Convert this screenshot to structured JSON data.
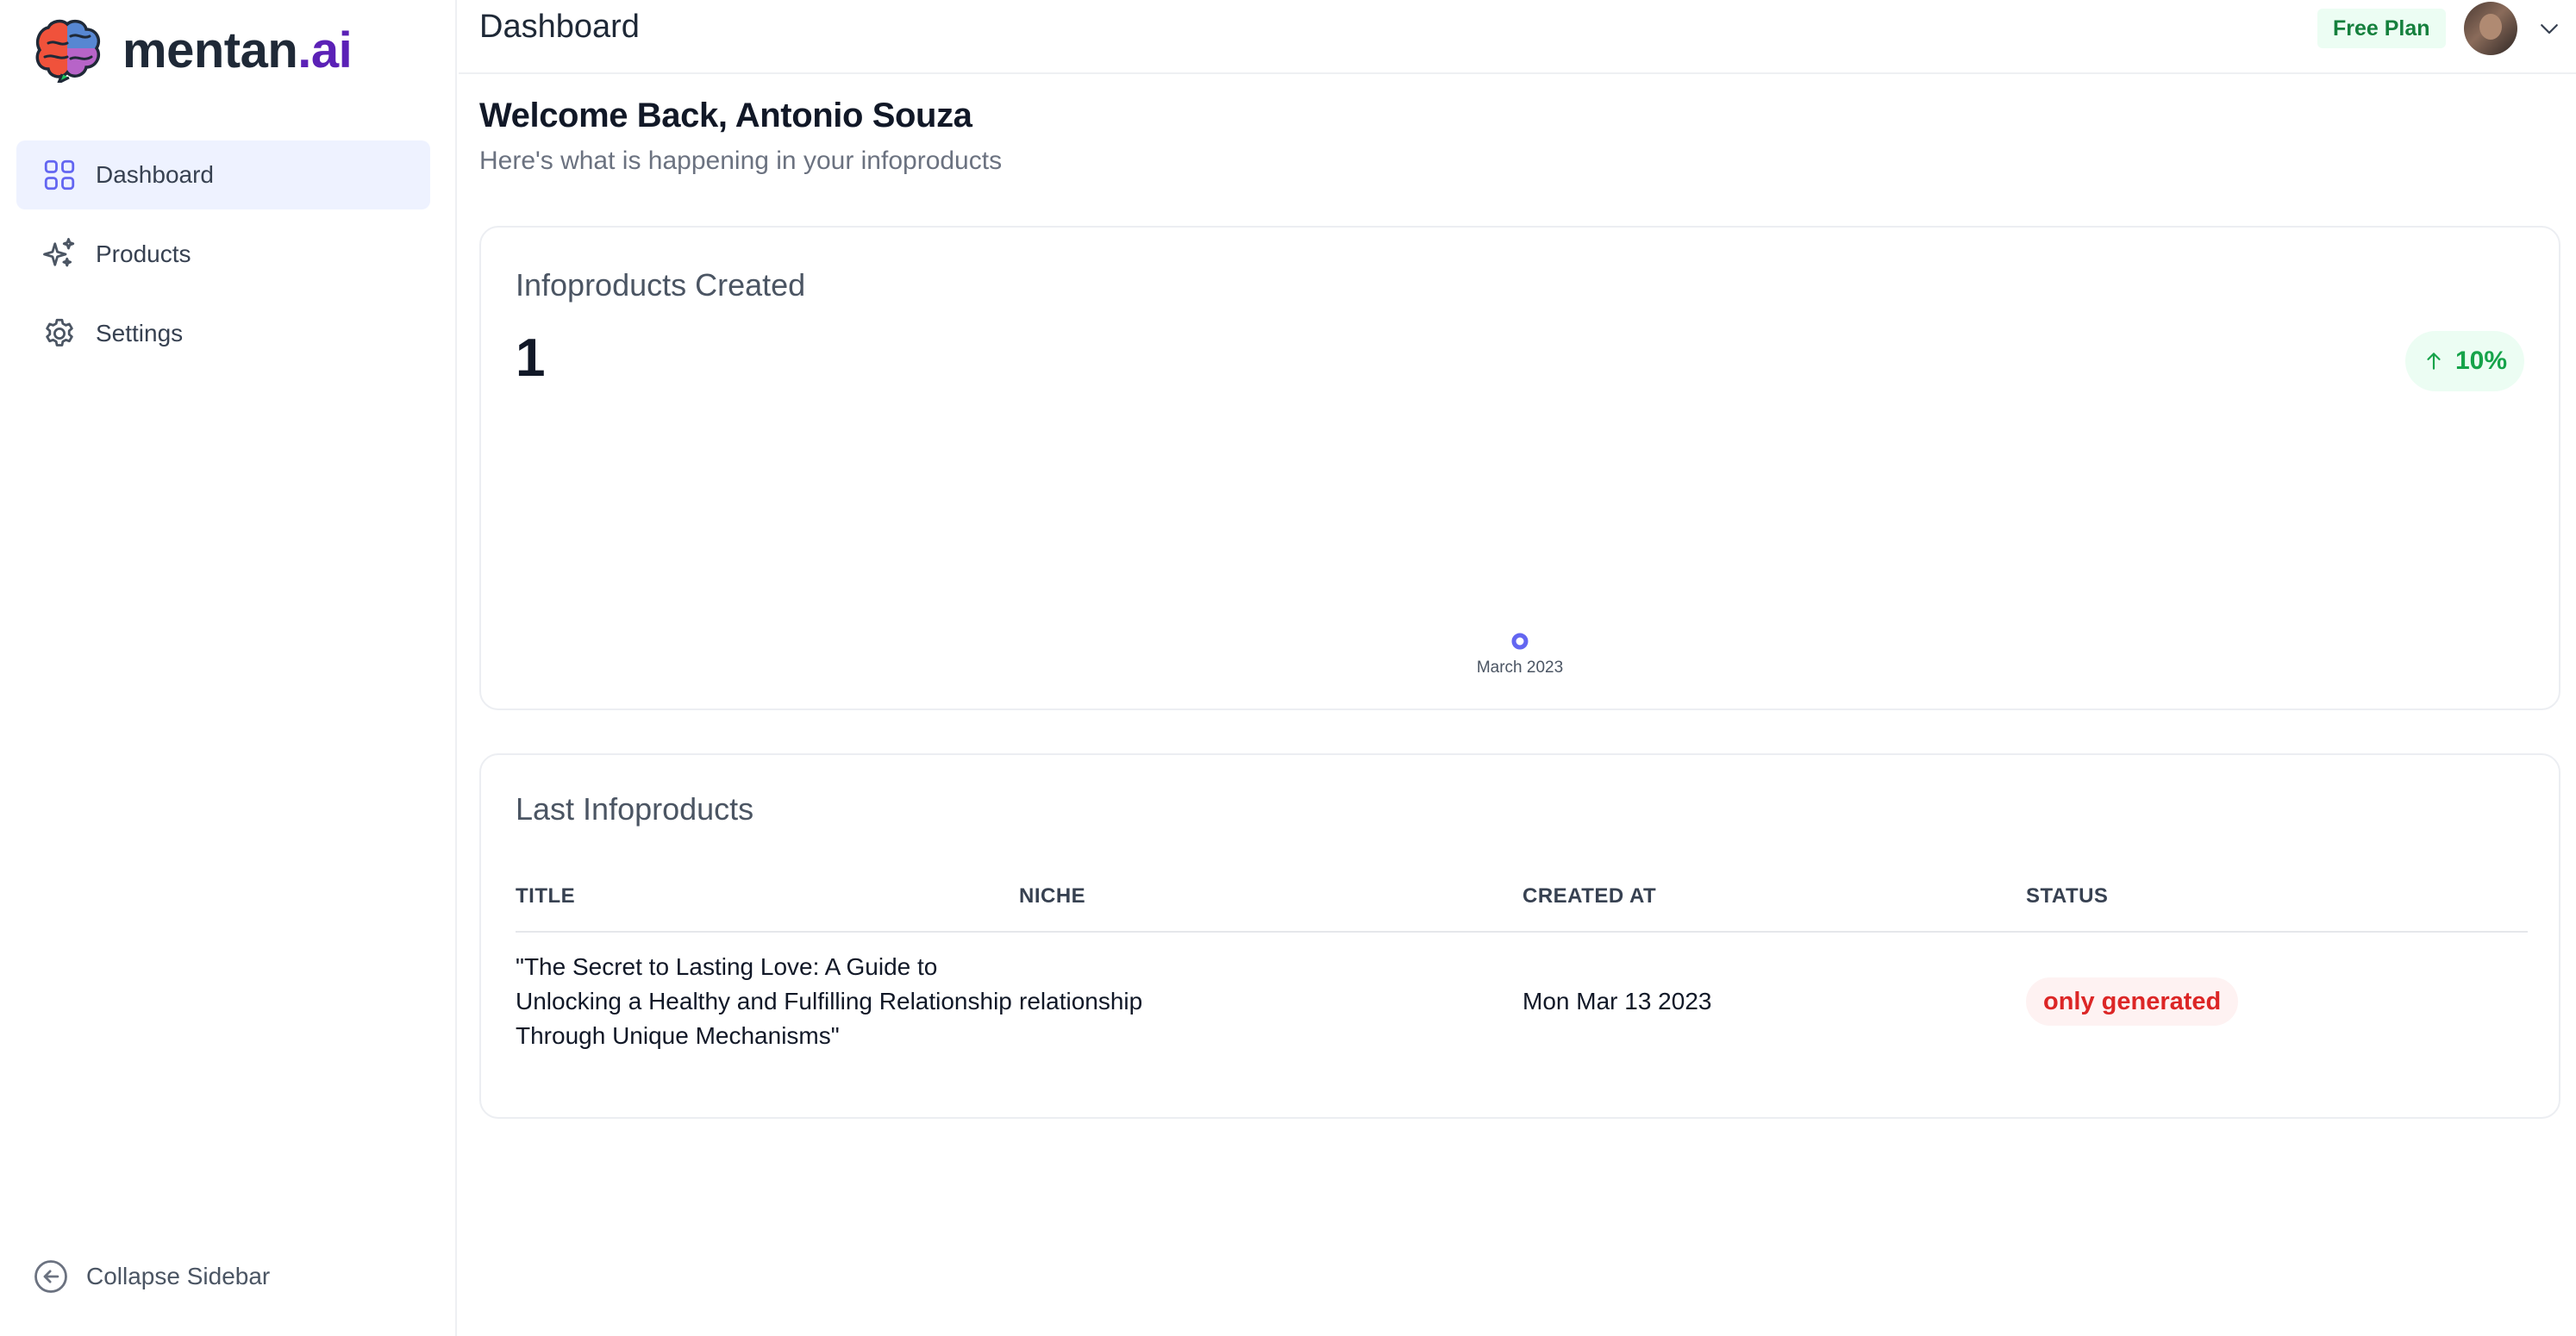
{
  "brand": {
    "name_main": "mentan",
    "name_accent": ".ai"
  },
  "sidebar": {
    "items": [
      {
        "label": "Dashboard",
        "icon": "grid-icon",
        "active": true
      },
      {
        "label": "Products",
        "icon": "sparkles-icon",
        "active": false
      },
      {
        "label": "Settings",
        "icon": "gear-icon",
        "active": false
      }
    ],
    "collapse_label": "Collapse Sidebar"
  },
  "header": {
    "title": "Dashboard",
    "plan_badge": "Free Plan"
  },
  "main": {
    "welcome": "Welcome Back, Antonio Souza",
    "subtitle": "Here's what is happening in your infoproducts"
  },
  "stats": {
    "title": "Infoproducts Created",
    "value": "1",
    "trend": "10%",
    "trend_direction": "up"
  },
  "chart_data": {
    "type": "line",
    "x": [
      "March 2023"
    ],
    "series": [
      {
        "values": [
          1
        ]
      }
    ],
    "title": "",
    "xlabel": "",
    "ylabel": "",
    "color": "#6366f1"
  },
  "last_products": {
    "title": "Last Infoproducts",
    "columns": [
      "TITLE",
      "NICHE",
      "CREATED AT",
      "STATUS"
    ],
    "rows": [
      {
        "title": "\"The Secret to Lasting Love: A Guide to Unlocking a Healthy and Fulfilling Relationship Through Unique Mechanisms\"",
        "niche": "relationship",
        "created_at": "Mon Mar 13 2023",
        "status": "only generated"
      }
    ]
  },
  "colors": {
    "accent": "#6366f1",
    "brand_accent": "#5b21b6",
    "success": "#16a34a",
    "danger": "#dc2626"
  }
}
